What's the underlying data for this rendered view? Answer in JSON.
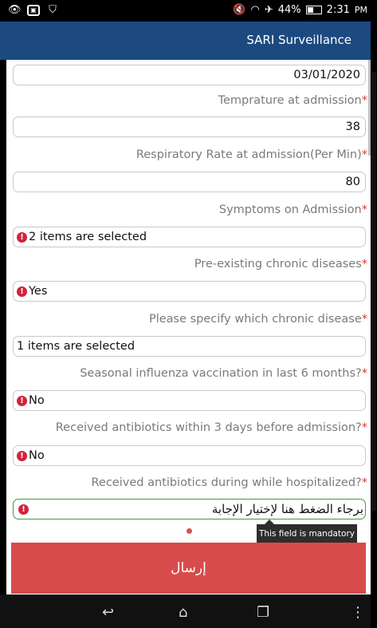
{
  "status_bar": {
    "battery": "44%",
    "time": "2:31",
    "ampm": "PM"
  },
  "app_bar": {
    "title": "SARI Surveillance"
  },
  "form": {
    "date_value": "03/01/2020",
    "fields": [
      {
        "label": "Temprature at admission",
        "value": "38"
      },
      {
        "label": "Respiratory Rate at admission(Per Min)",
        "value": "80"
      },
      {
        "label": "Symptoms on Admission",
        "value": "2 items are selected"
      },
      {
        "label": "Pre-existing chronic diseases",
        "value": "Yes"
      },
      {
        "label": "Please specify which chronic disease",
        "value": "1 items are selected"
      },
      {
        "label": "Seasonal influenza vaccination in last 6 months?",
        "value": "No"
      },
      {
        "label": "Received antibiotics within 3 days before admission?",
        "value": "No"
      },
      {
        "label": "Received antibiotics during while hospitalized?",
        "value": "برجاء الضغط هنا لإختيار الإجابة"
      }
    ],
    "required_marker": "*",
    "tooltip": "This field is mandatory",
    "submit_label": "إرسال"
  },
  "colors": {
    "app_bar": "#1c4a80",
    "submit": "#d84b4b",
    "error": "#d2233b",
    "focus": "#35a335"
  }
}
